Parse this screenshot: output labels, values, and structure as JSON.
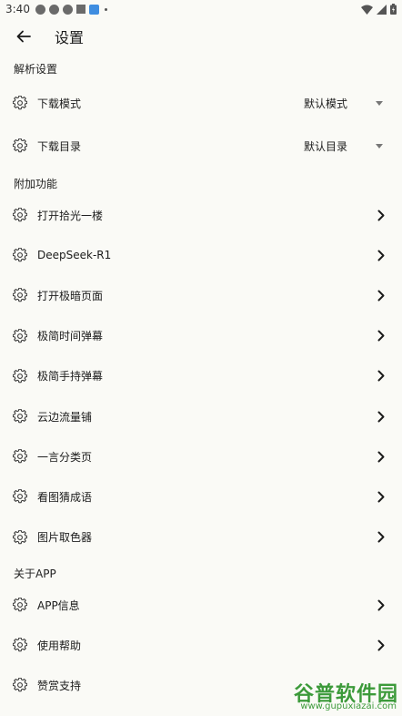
{
  "status_bar": {
    "time": "3:40"
  },
  "app_bar": {
    "title": "设置"
  },
  "sections": {
    "parse": {
      "header": "解析设置",
      "download_mode": {
        "label": "下载模式",
        "value": "默认模式"
      },
      "download_dir": {
        "label": "下载目录",
        "value": "默认目录"
      }
    },
    "extra": {
      "header": "附加功能",
      "items": [
        "打开拾光一楼",
        "DeepSeek-R1",
        "打开极暗页面",
        "极简时间弹幕",
        "极简手持弹幕",
        "云边流量铺",
        "一言分类页",
        "看图猜成语",
        "图片取色器"
      ]
    },
    "about": {
      "header": "关于APP",
      "items": [
        "APP信息",
        "使用帮助",
        "赞赏支持"
      ]
    }
  },
  "watermark": {
    "name": "谷普软件园",
    "url": "www.gupuxiazai.com"
  }
}
